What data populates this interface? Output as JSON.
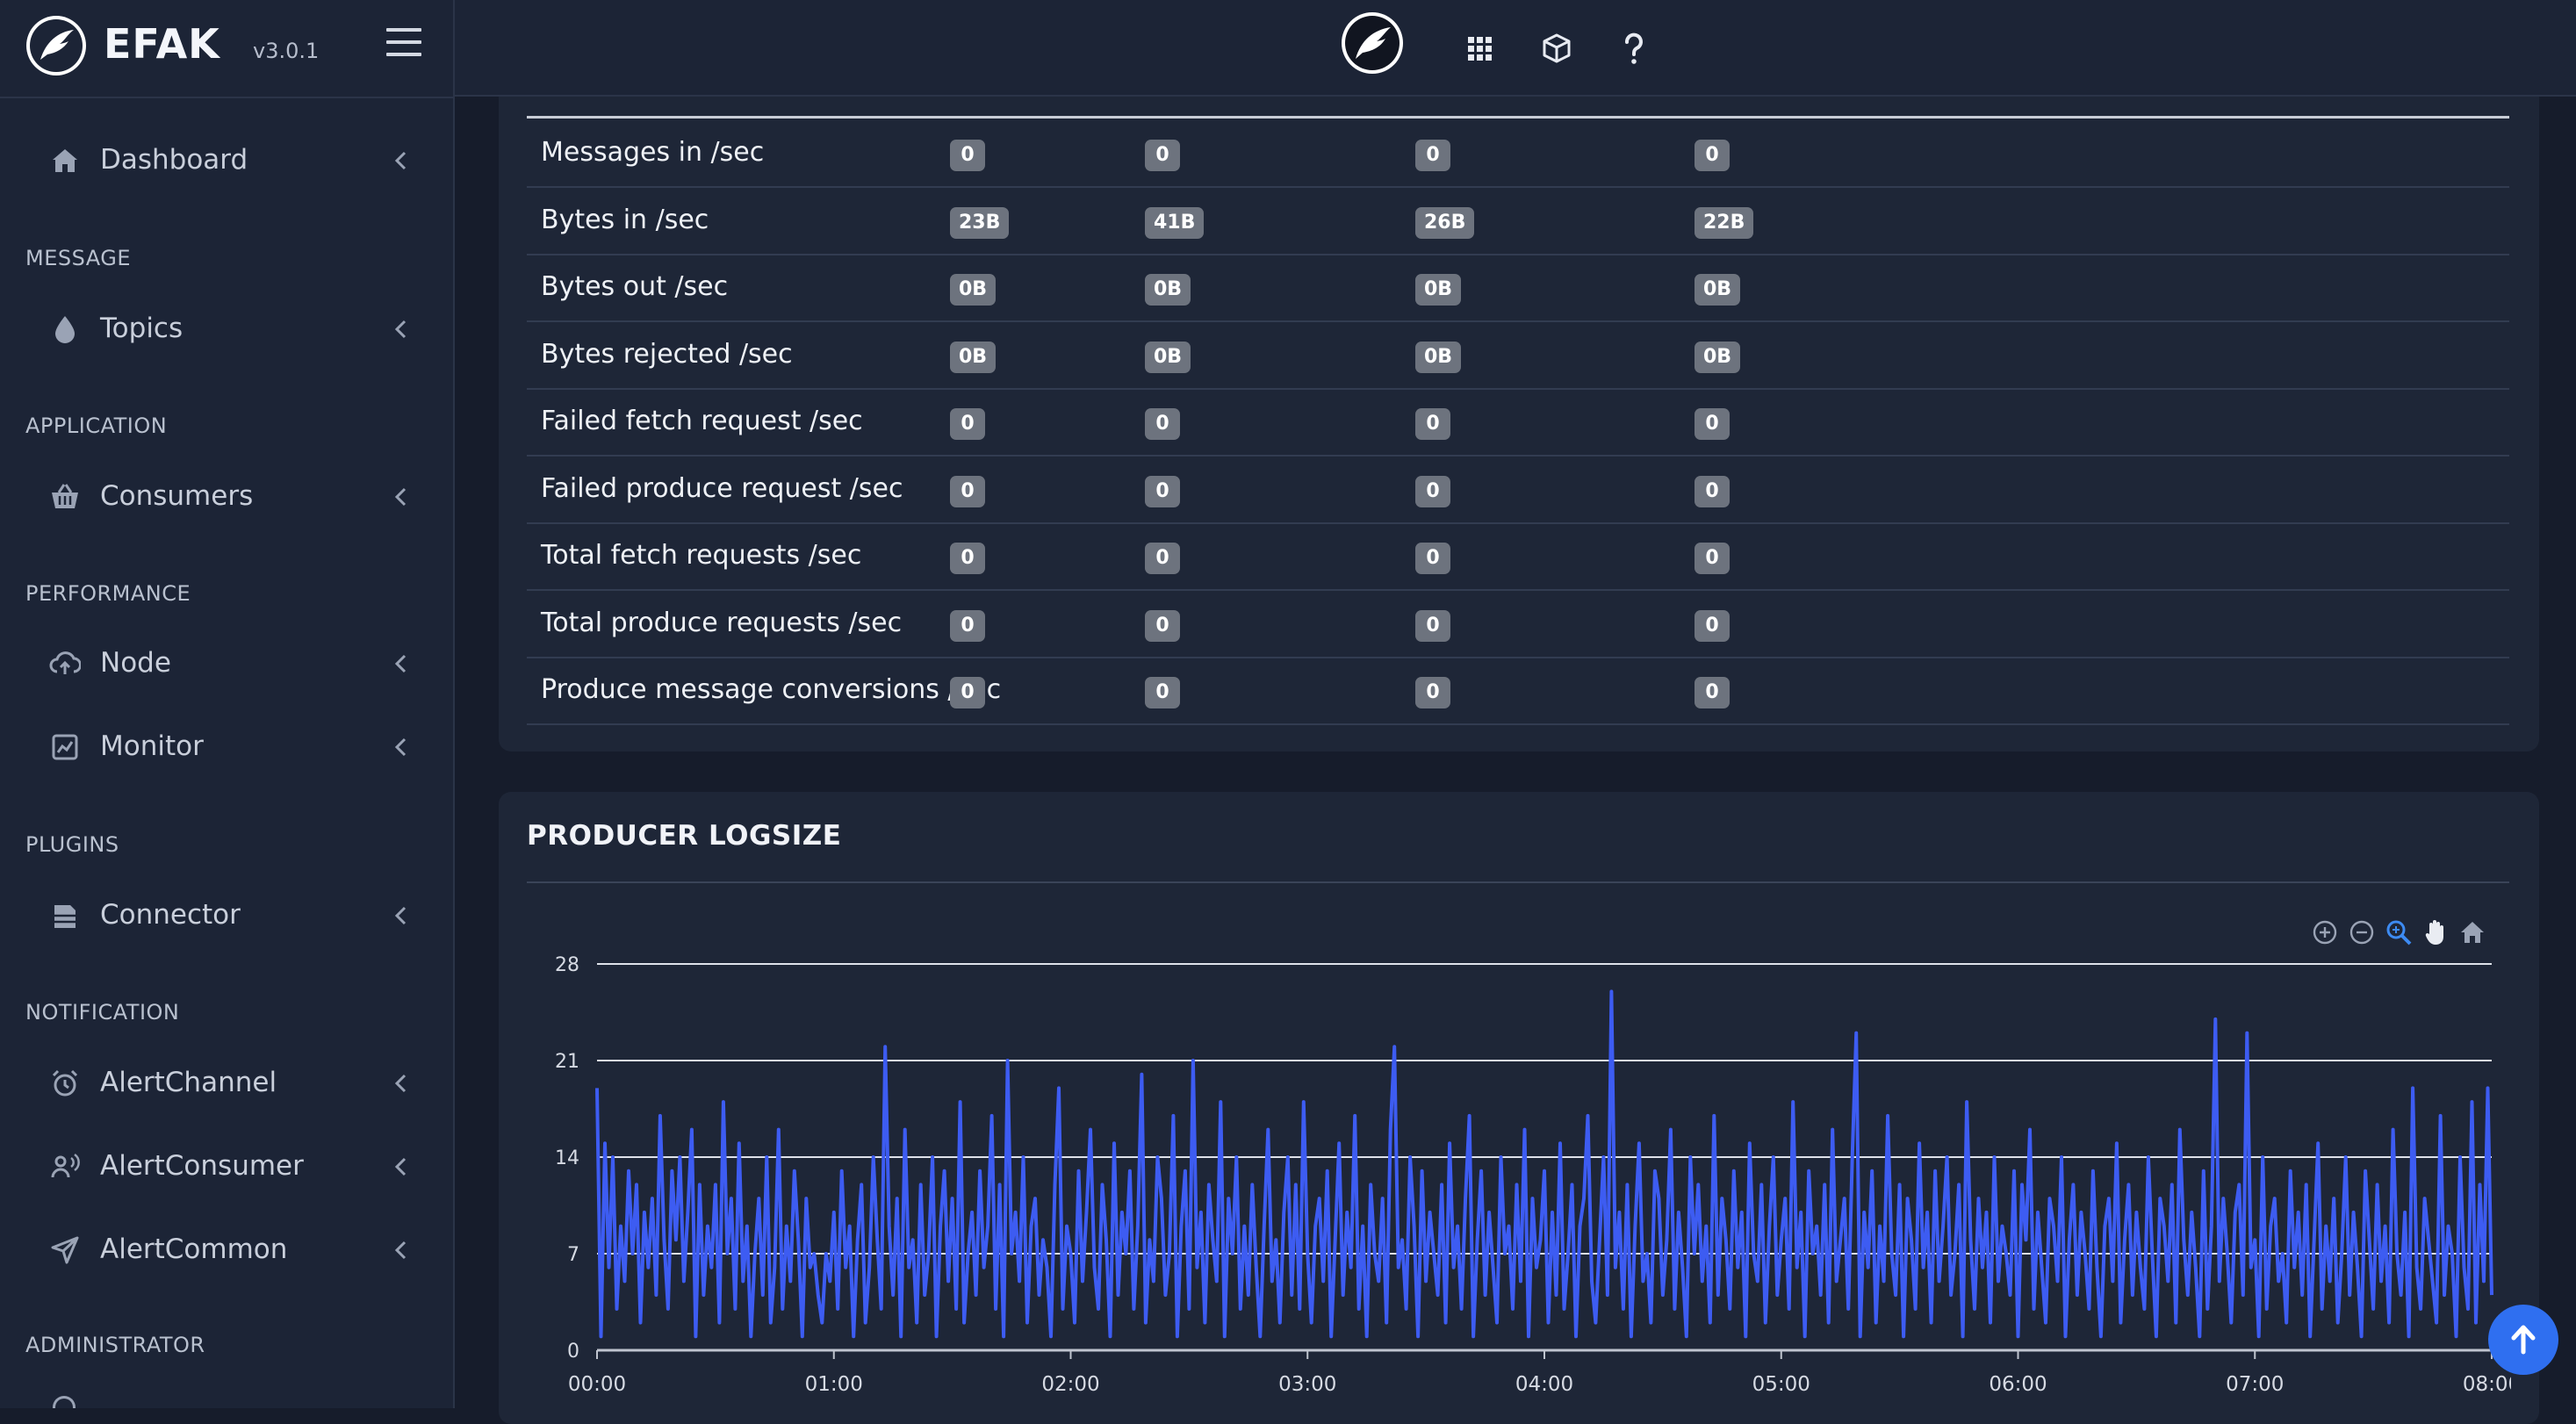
{
  "brand": {
    "name": "EFAK",
    "version": "v3.0.1"
  },
  "sidebar": {
    "sections": [
      {
        "title": "",
        "items": [
          {
            "label": "Dashboard",
            "icon": "home-icon"
          }
        ]
      },
      {
        "title": "MESSAGE",
        "items": [
          {
            "label": "Topics",
            "icon": "droplet-icon"
          }
        ]
      },
      {
        "title": "APPLICATION",
        "items": [
          {
            "label": "Consumers",
            "icon": "basket-icon"
          }
        ]
      },
      {
        "title": "PERFORMANCE",
        "items": [
          {
            "label": "Node",
            "icon": "cloud-upload-icon"
          },
          {
            "label": "Monitor",
            "icon": "chart-monitor-icon"
          }
        ]
      },
      {
        "title": "PLUGINS",
        "items": [
          {
            "label": "Connector",
            "icon": "database-icon"
          }
        ]
      },
      {
        "title": "NOTIFICATION",
        "items": [
          {
            "label": "AlertChannel",
            "icon": "alarm-clock-icon"
          },
          {
            "label": "AlertConsumer",
            "icon": "user-voice-icon"
          },
          {
            "label": "AlertCommon",
            "icon": "send-icon"
          }
        ]
      },
      {
        "title": "ADMINISTRATOR",
        "items": []
      }
    ]
  },
  "topbar": {
    "icons": [
      "avatar-logo-icon",
      "apps-grid-icon",
      "package-icon",
      "help-icon"
    ]
  },
  "metrics": {
    "rows": [
      {
        "label": "Messages in /sec",
        "values": [
          "0",
          "0",
          "0",
          "0"
        ]
      },
      {
        "label": "Bytes in /sec",
        "values": [
          "23B",
          "41B",
          "26B",
          "22B"
        ]
      },
      {
        "label": "Bytes out /sec",
        "values": [
          "0B",
          "0B",
          "0B",
          "0B"
        ]
      },
      {
        "label": "Bytes rejected /sec",
        "values": [
          "0B",
          "0B",
          "0B",
          "0B"
        ]
      },
      {
        "label": "Failed fetch request /sec",
        "values": [
          "0",
          "0",
          "0",
          "0"
        ]
      },
      {
        "label": "Failed produce request /sec",
        "values": [
          "0",
          "0",
          "0",
          "0"
        ]
      },
      {
        "label": "Total fetch requests /sec",
        "values": [
          "0",
          "0",
          "0",
          "0"
        ]
      },
      {
        "label": "Total produce requests /sec",
        "values": [
          "0",
          "0",
          "0",
          "0"
        ]
      },
      {
        "label": "Produce message conversions /sec",
        "values": [
          "0",
          "0",
          "0",
          "0"
        ]
      }
    ]
  },
  "producer_panel": {
    "title": "PRODUCER LOGSIZE",
    "tools": [
      "zoom-in-icon",
      "zoom-out-icon",
      "selection-zoom-icon",
      "pan-hand-icon",
      "reset-home-icon"
    ]
  },
  "colors": {
    "accent": "#3d5cf2",
    "badge": "#6d737e",
    "sidebar": "#1c2436",
    "panel": "#1e2637",
    "background": "#161c2b"
  },
  "chart_data": {
    "type": "line",
    "title": "PRODUCER LOGSIZE",
    "xlabel": "",
    "ylabel": "",
    "ylim": [
      0,
      28
    ],
    "xlim": [
      "00:00",
      "08:40"
    ],
    "y_ticks": [
      0,
      7,
      14,
      21,
      28
    ],
    "x_ticks": [
      "00:00",
      "01:00",
      "02:00",
      "03:00",
      "04:00",
      "05:00",
      "06:00",
      "07:00",
      "08:00"
    ],
    "grid": true,
    "x_minutes_step": 1,
    "series": [
      {
        "values": [
          19,
          1,
          15,
          6,
          14,
          3,
          9,
          5,
          13,
          7,
          12,
          2,
          10,
          6,
          11,
          4,
          17,
          8,
          3,
          13,
          8,
          14,
          5,
          10,
          16,
          1,
          12,
          4,
          9,
          6,
          12,
          2,
          18,
          7,
          11,
          3,
          15,
          5,
          9,
          1,
          7,
          11,
          4,
          14,
          2,
          6,
          16,
          3,
          9,
          5,
          13,
          8,
          1,
          11,
          6,
          7,
          4,
          2,
          7,
          5,
          10,
          3,
          13,
          6,
          9,
          1,
          8,
          12,
          2,
          6,
          14,
          8,
          3,
          22,
          9,
          4,
          11,
          1,
          16,
          6,
          8,
          2,
          12,
          4,
          7,
          14,
          1,
          9,
          13,
          5,
          11,
          3,
          18,
          2,
          7,
          10,
          4,
          13,
          6,
          9,
          17,
          3,
          12,
          1,
          21,
          7,
          10,
          5,
          14,
          2,
          9,
          11,
          4,
          8,
          6,
          1,
          12,
          19,
          3,
          9,
          7,
          2,
          13,
          5,
          10,
          16,
          6,
          3,
          12,
          8,
          1,
          15,
          4,
          10,
          7,
          13,
          3,
          9,
          20,
          2,
          8,
          5,
          14,
          11,
          4,
          7,
          17,
          1,
          9,
          13,
          3,
          21,
          6,
          10,
          2,
          12,
          8,
          5,
          18,
          1,
          11,
          7,
          14,
          3,
          9,
          4,
          12,
          6,
          1,
          9,
          16,
          5,
          8,
          2,
          10,
          14,
          4,
          12,
          3,
          18,
          7,
          2,
          9,
          11,
          5,
          13,
          1,
          8,
          15,
          4,
          10,
          6,
          17,
          3,
          9,
          1,
          12,
          7,
          5,
          11,
          2,
          16,
          22,
          6,
          8,
          3,
          14,
          9,
          1,
          13,
          5,
          10,
          7,
          4,
          12,
          2,
          15,
          6,
          9,
          3,
          11,
          17,
          1,
          8,
          13,
          4,
          10,
          6,
          2,
          14,
          7,
          9,
          3,
          12,
          5,
          16,
          1,
          11,
          6,
          8,
          13,
          2,
          10,
          4,
          15,
          3,
          7,
          12,
          1,
          9,
          11,
          17,
          5,
          2,
          8,
          14,
          4,
          26,
          6,
          10,
          3,
          12,
          1,
          9,
          15,
          5,
          7,
          2,
          13,
          11,
          4,
          8,
          16,
          3,
          10,
          6,
          1,
          14,
          7,
          12,
          5,
          9,
          2,
          17,
          4,
          11,
          8,
          3,
          13,
          6,
          10,
          1,
          15,
          7,
          5,
          12,
          2,
          9,
          14,
          4,
          8,
          11,
          3,
          18,
          6,
          10,
          1,
          13,
          7,
          9,
          4,
          12,
          2,
          16,
          5,
          8,
          11,
          3,
          14,
          23,
          1,
          10,
          6,
          13,
          2,
          9,
          5,
          17,
          7,
          4,
          12,
          1,
          11,
          8,
          3,
          15,
          6,
          10,
          2,
          13,
          5,
          9,
          14,
          4,
          7,
          12,
          1,
          18,
          8,
          3,
          11,
          6,
          10,
          2,
          14,
          5,
          9,
          7,
          4,
          13,
          1,
          12,
          8,
          16,
          3,
          10,
          6,
          2,
          11,
          9,
          5,
          14,
          1,
          8,
          12,
          4,
          10,
          7,
          3,
          13,
          6,
          1,
          9,
          11,
          5,
          15,
          2,
          8,
          12,
          4,
          10,
          6,
          3,
          14,
          7,
          1,
          11,
          9,
          5,
          12,
          2,
          16,
          8,
          4,
          10,
          6,
          1,
          13,
          3,
          9,
          24,
          5,
          11,
          7,
          2,
          10,
          12,
          4,
          23,
          6,
          8,
          1,
          14,
          3,
          9,
          11,
          5,
          7,
          2,
          13,
          6,
          10,
          4,
          12,
          1,
          8,
          15,
          3,
          9,
          5,
          11,
          2,
          7,
          14,
          4,
          10,
          6,
          1,
          13,
          8,
          3,
          12,
          5,
          9,
          2,
          16,
          7,
          4,
          10,
          1,
          19,
          6,
          3,
          11,
          8,
          5,
          2,
          17,
          4,
          9,
          7,
          1,
          14,
          6,
          3,
          18,
          2,
          12,
          5,
          19,
          4
        ]
      }
    ]
  }
}
